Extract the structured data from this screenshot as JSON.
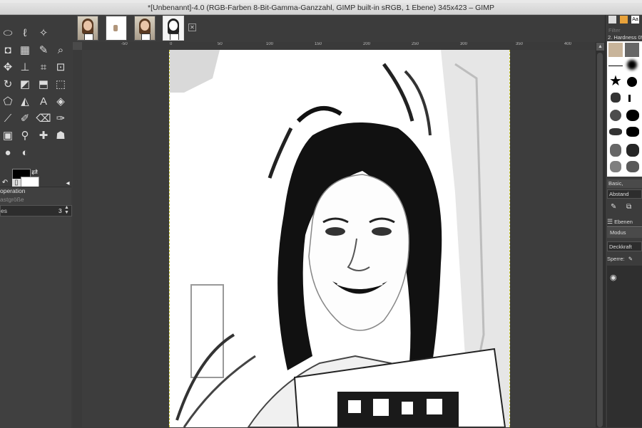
{
  "window": {
    "title": "*[Unbenannt]-4.0 (RGB-Farben 8-Bit-Gamma-Ganzzahl, GIMP built-in sRGB, 1 Ebene) 345x423 – GIMP"
  },
  "image_tabs": [
    {
      "name": "thumb-1",
      "kind": "photo"
    },
    {
      "name": "thumb-2",
      "kind": "small"
    },
    {
      "name": "thumb-3",
      "kind": "photo"
    },
    {
      "name": "thumb-4",
      "kind": "sketch"
    }
  ],
  "ruler": {
    "labels": [
      "-50",
      "0",
      "50",
      "100",
      "150",
      "200",
      "250",
      "300",
      "350",
      "400"
    ]
  },
  "tool_options": {
    "title": "operation",
    "subtitle": "astgröße",
    "row_label": "es",
    "row_value": "3"
  },
  "brushes": {
    "filter_placeholder": "Filter",
    "current_brush": "2. Hardness 05",
    "preset": "Basic,",
    "spacing_label": "Abstand"
  },
  "layers": {
    "tab_label": "Ebenen",
    "mode_label": "Modus",
    "opacity_label": "Deckkraft",
    "lock_label": "Sperre:"
  },
  "icons": {
    "foreground_color": "#000000",
    "background_color": "#ffffff"
  }
}
